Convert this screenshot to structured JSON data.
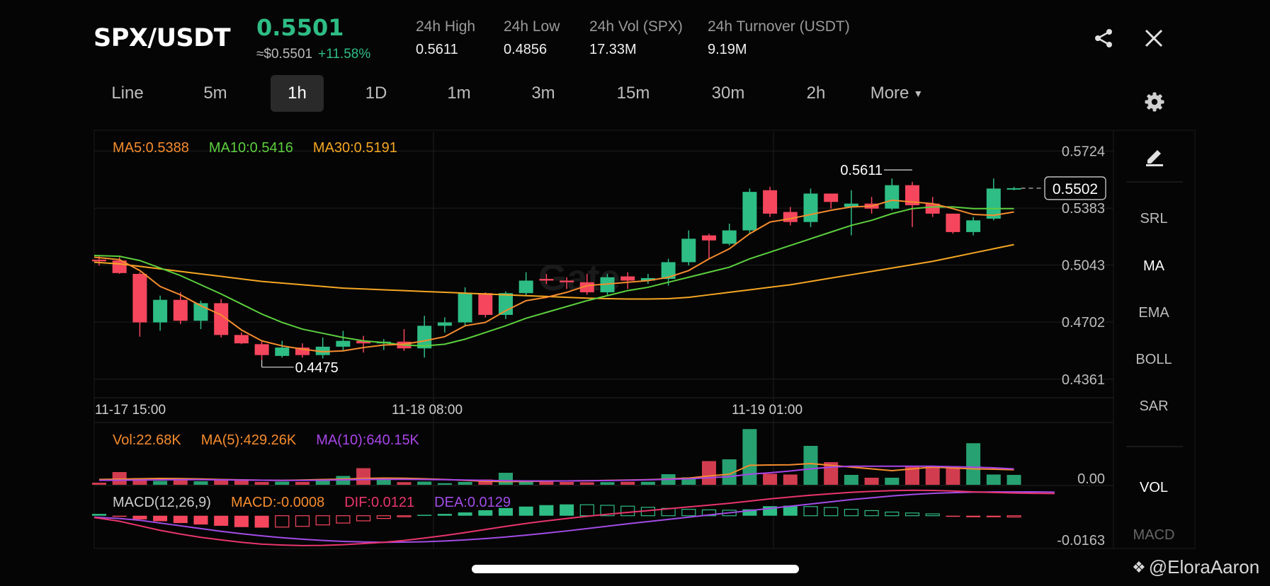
{
  "header": {
    "pair": "SPX/USDT",
    "price": "0.5501",
    "usd_price": "≈$0.5501",
    "change": "+11.58%",
    "stats": [
      {
        "label": "24h High",
        "value": "0.5611"
      },
      {
        "label": "24h Low",
        "value": "0.4856"
      },
      {
        "label": "24h Vol (SPX)",
        "value": "17.33M"
      },
      {
        "label": "24h Turnover (USDT)",
        "value": "9.19M"
      }
    ]
  },
  "timeframes": [
    "Line",
    "5m",
    "1h",
    "1D",
    "1m",
    "3m",
    "15m",
    "30m",
    "2h"
  ],
  "active_timeframe": "1h",
  "more_label": "More",
  "sidebar": {
    "items": [
      "SRL",
      "MA",
      "EMA",
      "BOLL",
      "SAR"
    ],
    "bottom_items": [
      "VOL",
      "MACD"
    ]
  },
  "colors": {
    "up": "#2ebd85",
    "down": "#f6465d",
    "ma5": "#f58c2e",
    "ma10": "#5ccf3e",
    "ma30": "#f5a623",
    "vol_ma10": "#a845e8",
    "dif": "#e8356d",
    "dea": "#a24ce6"
  },
  "watermark": "@EloraAaron",
  "chart_data": [
    {
      "type": "candlestick",
      "legend": [
        {
          "label": "MA5:0.5388",
          "color": "#f58c2e"
        },
        {
          "label": "MA10:0.5416",
          "color": "#5ccf3e"
        },
        {
          "label": "MA30:0.5191",
          "color": "#f5a623"
        }
      ],
      "ylim": [
        0.425,
        0.584
      ],
      "y_ticks": [
        0.4361,
        0.4702,
        0.5043,
        0.5383,
        0.5724
      ],
      "y_tick_labels": [
        "0.4361",
        "0.4702",
        "0.5043",
        "0.5383",
        "0.5724"
      ],
      "x_tick_labels": [
        {
          "index": 0,
          "label": "11-17 15:00"
        },
        {
          "index": 17,
          "label": "11-18 08:00"
        },
        {
          "index": 34,
          "label": "11-19 01:00"
        }
      ],
      "last_price_label": "0.5502",
      "last_price": 0.5502,
      "high_annotation": {
        "index": 40,
        "value": 0.5611,
        "label": "0.5611"
      },
      "low_annotation": {
        "index": 8,
        "value": 0.4475,
        "label": "0.4475"
      },
      "candles": [
        {
          "o": 0.5075,
          "h": 0.51,
          "l": 0.504,
          "c": 0.5065
        },
        {
          "o": 0.507,
          "h": 0.509,
          "l": 0.499,
          "c": 0.4995
        },
        {
          "o": 0.499,
          "h": 0.5,
          "l": 0.4615,
          "c": 0.47
        },
        {
          "o": 0.47,
          "h": 0.486,
          "l": 0.465,
          "c": 0.4835
        },
        {
          "o": 0.4835,
          "h": 0.488,
          "l": 0.469,
          "c": 0.471
        },
        {
          "o": 0.471,
          "h": 0.483,
          "l": 0.466,
          "c": 0.4815
        },
        {
          "o": 0.4815,
          "h": 0.484,
          "l": 0.461,
          "c": 0.4625
        },
        {
          "o": 0.4625,
          "h": 0.464,
          "l": 0.457,
          "c": 0.4575
        },
        {
          "o": 0.457,
          "h": 0.459,
          "l": 0.4475,
          "c": 0.4505
        },
        {
          "o": 0.45,
          "h": 0.459,
          "l": 0.449,
          "c": 0.455
        },
        {
          "o": 0.455,
          "h": 0.4575,
          "l": 0.449,
          "c": 0.4505
        },
        {
          "o": 0.4505,
          "h": 0.461,
          "l": 0.4485,
          "c": 0.4555
        },
        {
          "o": 0.4555,
          "h": 0.465,
          "l": 0.453,
          "c": 0.459
        },
        {
          "o": 0.459,
          "h": 0.462,
          "l": 0.452,
          "c": 0.4575
        },
        {
          "o": 0.4575,
          "h": 0.46,
          "l": 0.4535,
          "c": 0.4585
        },
        {
          "o": 0.4585,
          "h": 0.466,
          "l": 0.453,
          "c": 0.4545
        },
        {
          "o": 0.4545,
          "h": 0.474,
          "l": 0.449,
          "c": 0.468
        },
        {
          "o": 0.468,
          "h": 0.473,
          "l": 0.464,
          "c": 0.47
        },
        {
          "o": 0.47,
          "h": 0.491,
          "l": 0.468,
          "c": 0.4875
        },
        {
          "o": 0.4875,
          "h": 0.488,
          "l": 0.473,
          "c": 0.4745
        },
        {
          "o": 0.4745,
          "h": 0.4885,
          "l": 0.472,
          "c": 0.4875
        },
        {
          "o": 0.4875,
          "h": 0.5,
          "l": 0.486,
          "c": 0.495
        },
        {
          "o": 0.496,
          "h": 0.499,
          "l": 0.493,
          "c": 0.495
        },
        {
          "o": 0.495,
          "h": 0.497,
          "l": 0.49,
          "c": 0.494
        },
        {
          "o": 0.494,
          "h": 0.499,
          "l": 0.4865,
          "c": 0.488
        },
        {
          "o": 0.488,
          "h": 0.499,
          "l": 0.486,
          "c": 0.497
        },
        {
          "o": 0.4975,
          "h": 0.5,
          "l": 0.49,
          "c": 0.495
        },
        {
          "o": 0.495,
          "h": 0.499,
          "l": 0.493,
          "c": 0.4965
        },
        {
          "o": 0.496,
          "h": 0.508,
          "l": 0.492,
          "c": 0.506
        },
        {
          "o": 0.506,
          "h": 0.525,
          "l": 0.504,
          "c": 0.52
        },
        {
          "o": 0.522,
          "h": 0.523,
          "l": 0.508,
          "c": 0.519
        },
        {
          "o": 0.517,
          "h": 0.529,
          "l": 0.516,
          "c": 0.525
        },
        {
          "o": 0.525,
          "h": 0.55,
          "l": 0.523,
          "c": 0.548
        },
        {
          "o": 0.549,
          "h": 0.551,
          "l": 0.533,
          "c": 0.535
        },
        {
          "o": 0.536,
          "h": 0.539,
          "l": 0.528,
          "c": 0.53
        },
        {
          "o": 0.53,
          "h": 0.55,
          "l": 0.527,
          "c": 0.547
        },
        {
          "o": 0.547,
          "h": 0.547,
          "l": 0.538,
          "c": 0.542
        },
        {
          "o": 0.539,
          "h": 0.549,
          "l": 0.522,
          "c": 0.541
        },
        {
          "o": 0.541,
          "h": 0.545,
          "l": 0.535,
          "c": 0.538
        },
        {
          "o": 0.538,
          "h": 0.556,
          "l": 0.537,
          "c": 0.552
        },
        {
          "o": 0.552,
          "h": 0.554,
          "l": 0.527,
          "c": 0.54
        },
        {
          "o": 0.541,
          "h": 0.545,
          "l": 0.533,
          "c": 0.535
        },
        {
          "o": 0.535,
          "h": 0.535,
          "l": 0.523,
          "c": 0.524
        },
        {
          "o": 0.524,
          "h": 0.533,
          "l": 0.522,
          "c": 0.531
        },
        {
          "o": 0.532,
          "h": 0.556,
          "l": 0.531,
          "c": 0.55
        },
        {
          "o": 0.55,
          "h": 0.551,
          "l": 0.549,
          "c": 0.5502
        }
      ],
      "ma5": [
        0.509,
        0.5075,
        0.501,
        0.4915,
        0.4865,
        0.48,
        0.4745,
        0.4655,
        0.459,
        0.456,
        0.454,
        0.4525,
        0.453,
        0.455,
        0.4565,
        0.457,
        0.459,
        0.4615,
        0.468,
        0.47,
        0.477,
        0.483,
        0.485,
        0.488,
        0.492,
        0.493,
        0.494,
        0.495,
        0.497,
        0.501,
        0.508,
        0.514,
        0.523,
        0.53,
        0.532,
        0.5345,
        0.537,
        0.539,
        0.5395,
        0.543,
        0.542,
        0.541,
        0.538,
        0.5345,
        0.534,
        0.536
      ],
      "ma10": [
        0.51,
        0.5095,
        0.507,
        0.5025,
        0.498,
        0.4925,
        0.487,
        0.481,
        0.475,
        0.47,
        0.466,
        0.4635,
        0.461,
        0.459,
        0.458,
        0.4565,
        0.456,
        0.457,
        0.46,
        0.464,
        0.468,
        0.4725,
        0.476,
        0.4795,
        0.483,
        0.486,
        0.489,
        0.491,
        0.494,
        0.497,
        0.5,
        0.503,
        0.508,
        0.512,
        0.516,
        0.52,
        0.524,
        0.528,
        0.531,
        0.535,
        0.538,
        0.539,
        0.539,
        0.538,
        0.538,
        0.538
      ],
      "ma30": [
        0.506,
        0.505,
        0.5035,
        0.502,
        0.5005,
        0.499,
        0.4975,
        0.496,
        0.4945,
        0.4935,
        0.4925,
        0.4915,
        0.4905,
        0.49,
        0.4895,
        0.489,
        0.4885,
        0.488,
        0.4875,
        0.487,
        0.4865,
        0.486,
        0.4855,
        0.485,
        0.4845,
        0.4842,
        0.484,
        0.484,
        0.4842,
        0.485,
        0.4865,
        0.488,
        0.4895,
        0.491,
        0.4925,
        0.4945,
        0.4965,
        0.4985,
        0.5005,
        0.5025,
        0.5045,
        0.5065,
        0.509,
        0.5115,
        0.514,
        0.5165
      ]
    },
    {
      "type": "bar",
      "legend": [
        {
          "label": "Vol:22.68K",
          "color": "#f58c2e"
        },
        {
          "label": "MA(5):429.26K",
          "color": "#f58c2e"
        },
        {
          "label": "MA(10):640.15K",
          "color": "#a845e8"
        }
      ],
      "y_tick_labels": [
        "0.00"
      ],
      "ylim": [
        0,
        3200
      ],
      "values_k": [
        120,
        720,
        380,
        220,
        260,
        200,
        300,
        260,
        160,
        180,
        160,
        320,
        500,
        940,
        320,
        150,
        180,
        90,
        160,
        300,
        680,
        250,
        200,
        160,
        140,
        150,
        170,
        170,
        600,
        420,
        1340,
        1440,
        3150,
        620,
        580,
        2200,
        1280,
        560,
        400,
        400,
        1060,
        1080,
        1050,
        2350,
        580,
        560,
        480,
        920
      ],
      "ma5_k": [
        300,
        320,
        340,
        360,
        350,
        330,
        300,
        280,
        260,
        250,
        270,
        300,
        320,
        360,
        380,
        370,
        340,
        300,
        250,
        200,
        180,
        190,
        210,
        220,
        230,
        250,
        270,
        290,
        330,
        380,
        500,
        600,
        1100,
        1120,
        1130,
        1200,
        1100,
        1000,
        900,
        800,
        900,
        1000,
        950,
        900,
        880,
        850,
        820,
        430
      ],
      "ma10_k": [
        250,
        260,
        270,
        280,
        290,
        290,
        280,
        270,
        260,
        250,
        250,
        260,
        280,
        300,
        310,
        310,
        300,
        290,
        270,
        250,
        230,
        220,
        220,
        220,
        230,
        240,
        260,
        280,
        310,
        340,
        400,
        460,
        600,
        680,
        780,
        900,
        1000,
        1050,
        1050,
        1050,
        1050,
        1050,
        1020,
        1000,
        960,
        900,
        840,
        640
      ]
    },
    {
      "type": "bar",
      "legend": [
        {
          "label": "MACD(12,26,9)",
          "color": "#cccccc"
        },
        {
          "label": "MACD:-0.0008",
          "color": "#f58c2e"
        },
        {
          "label": "DIF:0.0121",
          "color": "#e8356d"
        },
        {
          "label": "DEA:0.0129",
          "color": "#a24ce6"
        }
      ],
      "y_tick_labels": [
        "-0.0163"
      ],
      "ylim": [
        -0.0175,
        0.0165
      ],
      "macd": [
        0.001,
        -0.0005,
        -0.002,
        -0.003,
        -0.004,
        -0.0048,
        -0.0055,
        -0.0062,
        -0.0065,
        -0.0062,
        -0.0058,
        -0.005,
        -0.004,
        -0.0028,
        -0.0015,
        -0.0003,
        0.0005,
        0.001,
        0.0018,
        0.003,
        0.0042,
        0.005,
        0.0058,
        0.0062,
        0.006,
        0.0057,
        0.0052,
        0.0046,
        0.004,
        0.0035,
        0.0032,
        0.003,
        0.0035,
        0.0052,
        0.0055,
        0.005,
        0.0045,
        0.0035,
        0.0028,
        0.002,
        0.0015,
        0.001,
        -0.0004,
        -0.0008,
        -0.0008,
        -0.0007,
        -0.0006,
        -0.0008
      ],
      "dif": [
        -0.001,
        -0.003,
        -0.0055,
        -0.008,
        -0.01,
        -0.0118,
        -0.0132,
        -0.0145,
        -0.0155,
        -0.016,
        -0.0163,
        -0.0162,
        -0.0158,
        -0.0152,
        -0.0145,
        -0.0135,
        -0.0122,
        -0.0108,
        -0.0092,
        -0.0075,
        -0.0058,
        -0.0042,
        -0.0028,
        -0.0015,
        -0.0003,
        0.0008,
        0.0018,
        0.0028,
        0.0038,
        0.0048,
        0.0058,
        0.0068,
        0.008,
        0.0092,
        0.0102,
        0.0112,
        0.012,
        0.0128,
        0.0133,
        0.0137,
        0.0139,
        0.0138,
        0.0135,
        0.013,
        0.0127,
        0.0124,
        0.0122,
        0.0121
      ],
      "dea": [
        -0.0008,
        -0.0015,
        -0.0025,
        -0.004,
        -0.0055,
        -0.007,
        -0.0085,
        -0.0098,
        -0.011,
        -0.012,
        -0.0128,
        -0.0135,
        -0.014,
        -0.0143,
        -0.0145,
        -0.0144,
        -0.0142,
        -0.0138,
        -0.0132,
        -0.0125,
        -0.0116,
        -0.0106,
        -0.0095,
        -0.0083,
        -0.007,
        -0.0057,
        -0.0044,
        -0.0032,
        -0.002,
        -0.0008,
        0.0004,
        0.0016,
        0.0028,
        0.004,
        0.0052,
        0.0064,
        0.0076,
        0.0088,
        0.0098,
        0.0108,
        0.0116,
        0.0122,
        0.0126,
        0.0129,
        0.013,
        0.013,
        0.013,
        0.0129
      ]
    }
  ]
}
